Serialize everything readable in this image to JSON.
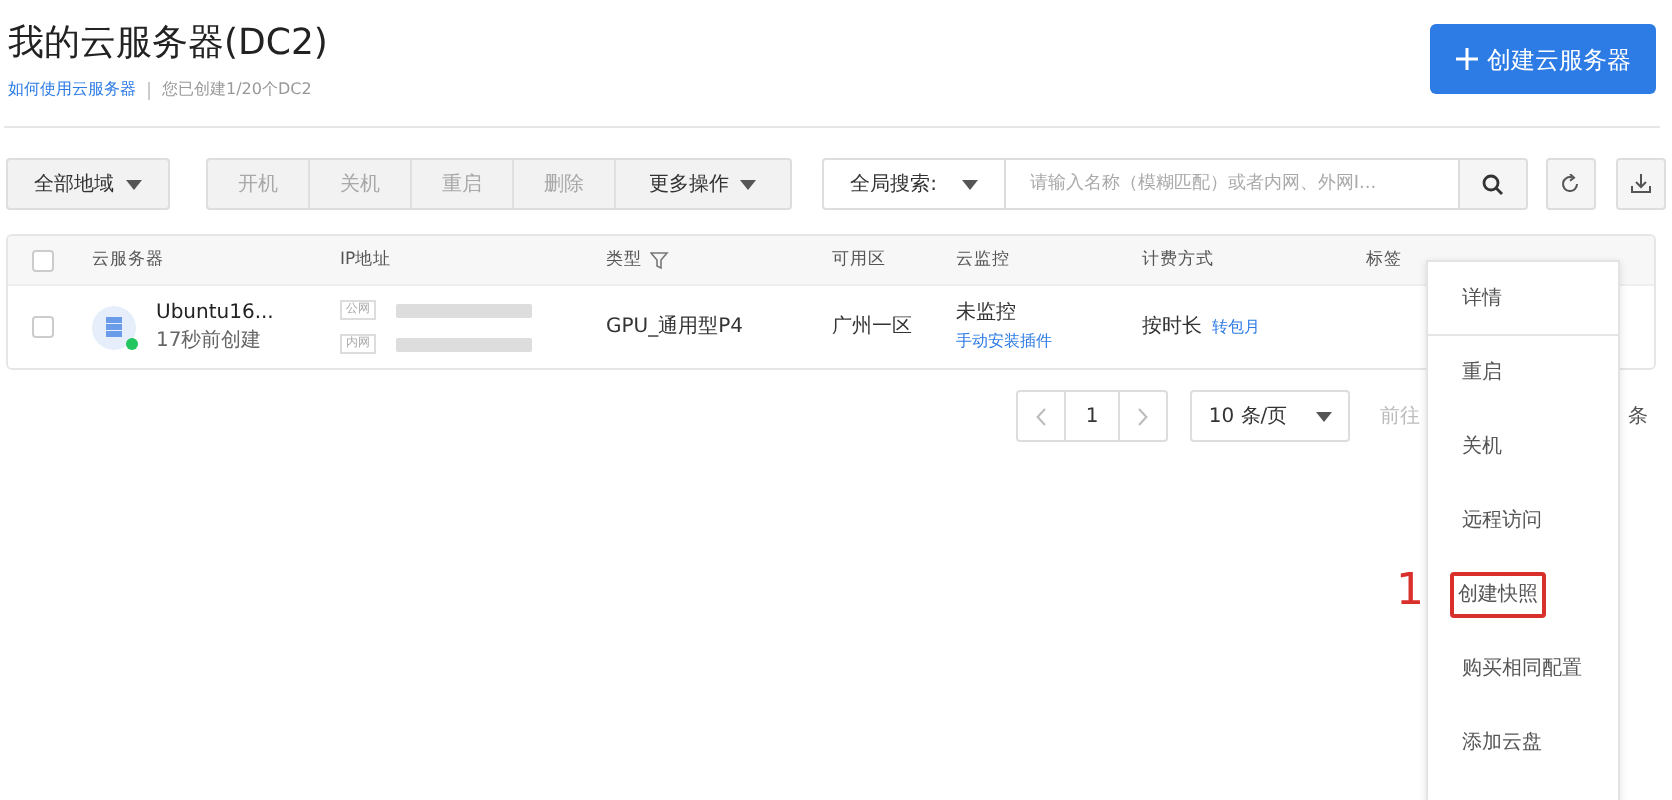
{
  "header": {
    "title": "我的云服务器(DC2)",
    "help_link": "如何使用云服务器",
    "quota": "您已创建1/20个DC2",
    "create_button": "创建云服务器"
  },
  "toolbar": {
    "region": "全部地域",
    "actions": [
      {
        "label": "开机",
        "disabled": true
      },
      {
        "label": "关机",
        "disabled": true
      },
      {
        "label": "重启",
        "disabled": true
      },
      {
        "label": "删除",
        "disabled": true
      },
      {
        "label": "更多操作",
        "disabled": false
      }
    ],
    "search_scope": "全局搜索:",
    "search_placeholder": "请输入名称（模糊匹配）或者内网、外网I..."
  },
  "table": {
    "all_checked": false,
    "columns": [
      "云服务器",
      "IP地址",
      "类型",
      "可用区",
      "云监控",
      "计费方式",
      "标签"
    ],
    "rows": [
      {
        "checked": false,
        "name": "Ubuntu16...",
        "created": "17秒前创建",
        "online": true,
        "public_tag": "公网",
        "private_tag": "内网",
        "type": "GPU_通用型P4",
        "zone": "广州一区",
        "monitor": "未监控",
        "monitor_link": "手动安装插件",
        "billing": "按时长",
        "billing_link": "转包月"
      }
    ]
  },
  "pagination": {
    "page": "1",
    "page_size": "10 条/页",
    "goto": "前往",
    "unit": "条"
  },
  "menu": {
    "items": [
      {
        "label": "详情",
        "highlighted": false
      },
      {
        "label": "重启",
        "highlighted": false
      },
      {
        "label": "关机",
        "highlighted": false
      },
      {
        "label": "远程访问",
        "highlighted": false
      },
      {
        "label": "创建快照",
        "highlighted": true
      },
      {
        "label": "购买相同配置",
        "highlighted": false
      },
      {
        "label": "添加云盘",
        "highlighted": false
      }
    ],
    "annotation": "1"
  }
}
